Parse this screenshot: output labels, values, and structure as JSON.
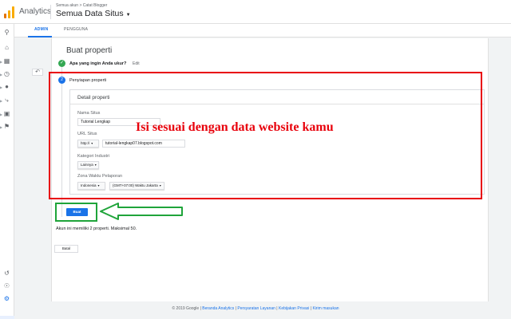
{
  "header": {
    "app_name": "Analytics",
    "breadcrumb": "Semua akun > Catat Blogger",
    "property_select": "Semua Data Situs"
  },
  "tabs": [
    {
      "label": "ADMIN",
      "active": true
    },
    {
      "label": "PENGGUNA",
      "active": false
    }
  ],
  "rail_icons": [
    "search-icon",
    "home-icon",
    "customization-icon",
    "realtime-icon",
    "audience-icon",
    "acquisition-icon",
    "behavior-icon",
    "conversions-icon",
    "attribution-icon",
    "discover-icon",
    "admin-gear-icon"
  ],
  "page": {
    "title": "Buat properti",
    "back_icon": "↶"
  },
  "step1": {
    "check": "✓",
    "label": "Apa yang ingin Anda ukur?",
    "edit": "Edit"
  },
  "step2": {
    "number": "2",
    "label": "Penyiapan properti"
  },
  "detail": {
    "title": "Detail properti",
    "site_name_label": "Nama Situs",
    "site_name_value": "Tutorial Lengkap",
    "url_label": "URL Situs",
    "url_protocol": "http://",
    "url_value": "tutorial-lengkap07.blogspot.com",
    "category_label": "Kategori Industri",
    "category_value": "Lainnya",
    "timezone_label": "Zona Waktu Pelaporan",
    "timezone_country": "Indonesia",
    "timezone_value": "(GMT+07:00) Waktu Jakarta"
  },
  "annotation": "Isi sesuai dengan data website kamu",
  "buttons": {
    "create": "Buat",
    "cancel": "Batal"
  },
  "info_text": "Akun ini memiliki 2 properti. Maksimal 50.",
  "footer": {
    "copyright": "© 2019 Google",
    "links": [
      "Beranda Analytics",
      "Persyaratan Layanan",
      "Kebijakan Privasi",
      "Kirim masukan"
    ]
  },
  "colors": {
    "accent": "#1a73e8",
    "annotation_red": "#e8000b",
    "annotation_green": "#1fa43a",
    "success": "#34a853"
  }
}
